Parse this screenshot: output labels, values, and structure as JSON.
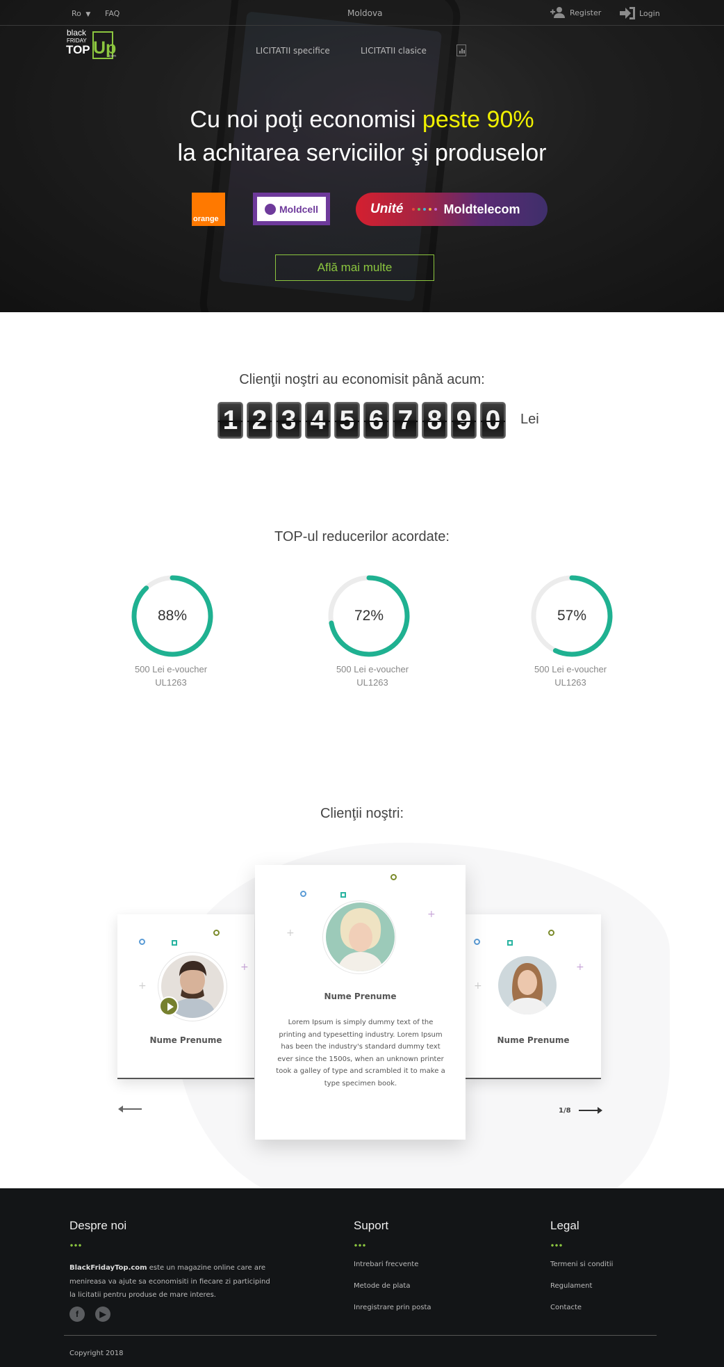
{
  "topbar": {
    "language": "Ro",
    "language_caret": "▼",
    "faq": "FAQ",
    "region": "Moldova",
    "register": "Register",
    "login": "Login"
  },
  "logo": {
    "line1": "black",
    "line2": "FRIDAY",
    "line3": "TOP",
    "line4": "Up",
    "domain": ".com"
  },
  "nav": {
    "item1": "LICITATII specifice",
    "item2": "LICITATII clasice"
  },
  "hero": {
    "title_part1": "Cu noi poţi economisi ",
    "title_highlight": "peste 90%",
    "title_line2": "la achitarea serviciilor şi produselor",
    "cta": "Află mai multe",
    "brands": {
      "orange": "orange",
      "moldcell": "Moldcell",
      "unite": "Unité",
      "moldtelecom": "Moldtelecom"
    },
    "unite_dot_colors": [
      "#e9473f",
      "#6ac05a",
      "#48b3d5",
      "#f0b83c",
      "#c46ad3"
    ]
  },
  "savings": {
    "title": "Clienţii noştri au economisit până acum:",
    "digits": [
      "1",
      "2",
      "3",
      "4",
      "5",
      "6",
      "7",
      "8",
      "9",
      "0"
    ],
    "currency": "Lei"
  },
  "discounts": {
    "title": "TOP-ul reducerilor acordate:",
    "accent_color": "#1fb191",
    "items": [
      {
        "percent": 88,
        "percent_label": "88%",
        "line1": "500 Lei e-voucher",
        "line2": "UL1263"
      },
      {
        "percent": 72,
        "percent_label": "72%",
        "line1": "500 Lei e-voucher",
        "line2": "UL1263"
      },
      {
        "percent": 57,
        "percent_label": "57%",
        "line1": "500 Lei e-voucher",
        "line2": "UL1263"
      }
    ]
  },
  "clients": {
    "title": "Clienţii noştri:",
    "pager": "1/8",
    "cards": [
      {
        "name": "Nume Prenume"
      },
      {
        "name": "Nume Prenume",
        "quote": "Lorem Ipsum is simply dummy text of the printing and typesetting industry. Lorem Ipsum has been the industry's standard dummy text ever since the 1500s, when an unknown printer took a galley of type and scrambled it to make a type specimen book."
      },
      {
        "name": "Nume Prenume"
      }
    ]
  },
  "footer": {
    "about": {
      "title": "Despre noi",
      "site": "BlackFridayTop.com",
      "text": " este un magazine online care are menireasa va ajute sa economisiti in fiecare zi participind la licitatii pentru produse de mare interes."
    },
    "support": {
      "title": "Suport",
      "links": [
        "Intrebari frecvente",
        "Metode de plata",
        "Inregistrare prin posta"
      ]
    },
    "legal": {
      "title": "Legal",
      "links": [
        "Termeni si conditii",
        "Regulament",
        "Contacte"
      ]
    },
    "copyright": "Copyright 2018"
  }
}
